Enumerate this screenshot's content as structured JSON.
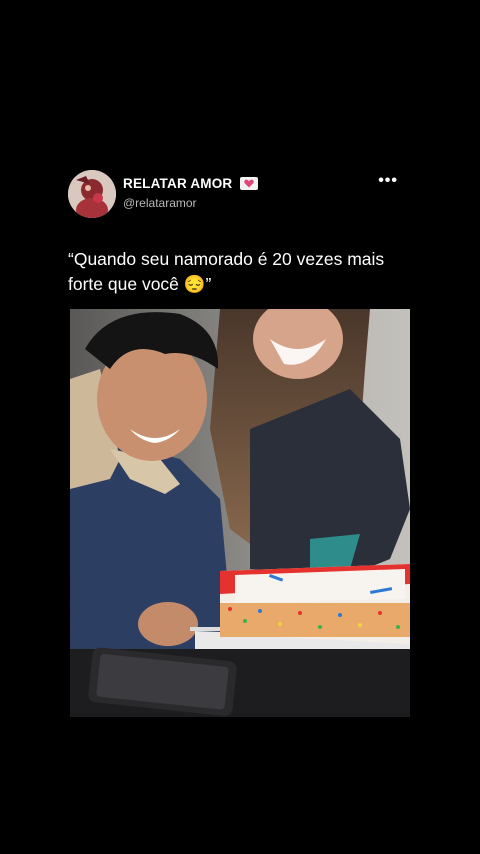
{
  "post": {
    "display_name": "RELATAR AMOR",
    "handle": "@relataramor",
    "more_label": "•••",
    "caption": "“Quando seu namorado é 20 vezes mais forte que você 😔”"
  },
  "icons": {
    "verified_badge": "heart-icon",
    "more": "more-options-icon"
  },
  "colors": {
    "background": "#000000",
    "text": "#ffffff",
    "handle": "#b8b8b8",
    "badge_heart": "#e0457b"
  }
}
